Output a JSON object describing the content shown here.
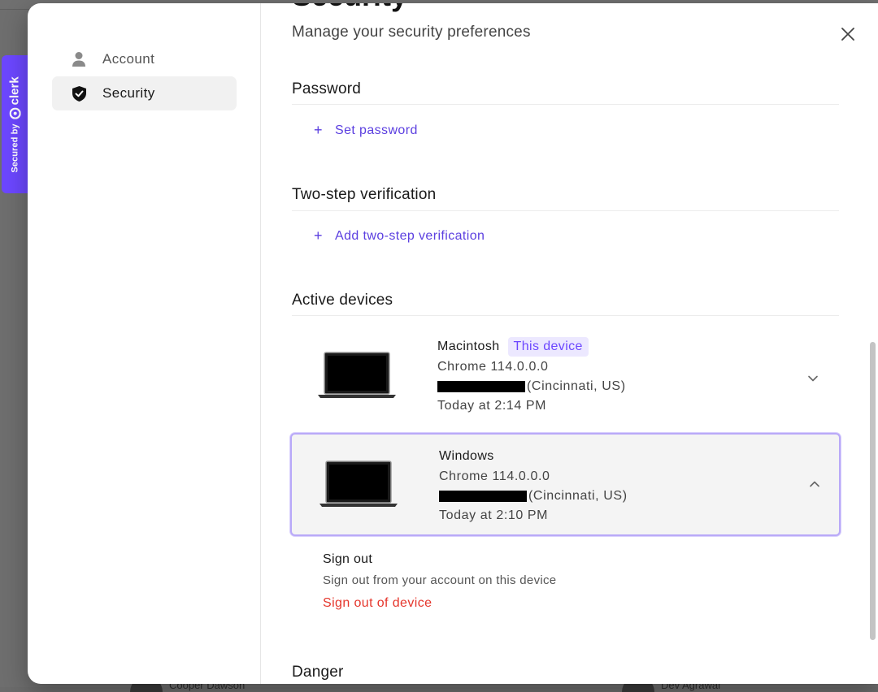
{
  "badge": {
    "secured_by": "Secured by",
    "brand": "clerk",
    "accent": "#6c47ff"
  },
  "background": {
    "names": [
      "Cooper Dawson",
      "Dev Agrawal"
    ]
  },
  "nav": {
    "items": [
      {
        "label": "Account",
        "icon": "person-icon",
        "active": false
      },
      {
        "label": "Security",
        "icon": "shield-check-icon",
        "active": true
      }
    ]
  },
  "header": {
    "title": "Security",
    "subtitle": "Manage your security preferences",
    "close_icon": "close-icon"
  },
  "password": {
    "title": "Password",
    "action": "Set password"
  },
  "two_step": {
    "title": "Two-step verification",
    "action": "Add two-step verification"
  },
  "devices": {
    "title": "Active devices",
    "items": [
      {
        "name": "Macintosh",
        "badge": "This device",
        "browser": "Chrome 114.0.0.0",
        "location": "(Cincinnati, US)",
        "time": "Today at 2:14 PM",
        "expanded": false
      },
      {
        "name": "Windows",
        "browser": "Chrome 114.0.0.0",
        "location": "(Cincinnati, US)",
        "time": "Today at 2:10 PM",
        "expanded": true
      }
    ],
    "sign_out": {
      "title": "Sign out",
      "description": "Sign out from your account on this device",
      "action": "Sign out of device"
    }
  },
  "danger": {
    "title": "Danger"
  },
  "colors": {
    "link": "#5b3fe0",
    "danger": "#e5352b",
    "selected_border": "#b9a9f8"
  }
}
